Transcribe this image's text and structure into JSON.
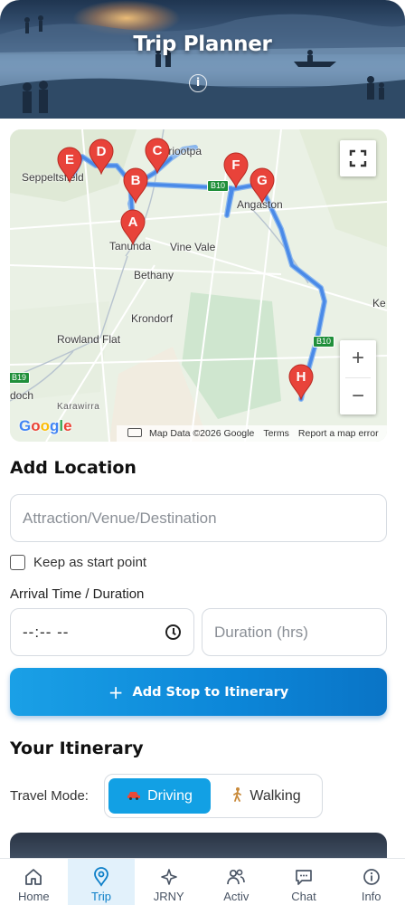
{
  "header": {
    "title": "Trip Planner",
    "info_icon": "info-circle-icon"
  },
  "map": {
    "places": [
      "Seppeltsfield",
      "Nuriootpa",
      "Tanunda",
      "Vine Vale",
      "Bethany",
      "Angaston",
      "Krondorf",
      "Rowland Flat",
      "Karawirra",
      "doch",
      "Ke"
    ],
    "road_shields": [
      "B10",
      "B10",
      "B19"
    ],
    "markers": [
      "A",
      "B",
      "C",
      "D",
      "E",
      "F",
      "G",
      "H"
    ],
    "google_logo": "Google",
    "attribution": {
      "map_data": "Map Data ©2026 Google",
      "terms": "Terms",
      "report": "Report a map error"
    },
    "zoom_in": "+",
    "zoom_out": "−"
  },
  "add_location": {
    "title": "Add Location",
    "destination_placeholder": "Attraction/Venue/Destination",
    "keep_start_label": "Keep as start point",
    "arrival_label": "Arrival Time / Duration",
    "time_value": "--:-- --",
    "duration_placeholder": "Duration (hrs)",
    "add_button_label": "Add Stop to Itinerary"
  },
  "itinerary": {
    "title": "Your Itinerary",
    "travel_mode_label": "Travel Mode:",
    "modes": [
      "Driving",
      "Walking"
    ],
    "active_mode": "Driving"
  },
  "bottom_nav": {
    "items": [
      "Home",
      "Trip",
      "JRNY",
      "Activ",
      "Chat",
      "Info"
    ],
    "active": "Trip"
  },
  "colors": {
    "accent": "#12a0e4",
    "route": "#4a8ae8",
    "marker": "#e8433a"
  }
}
